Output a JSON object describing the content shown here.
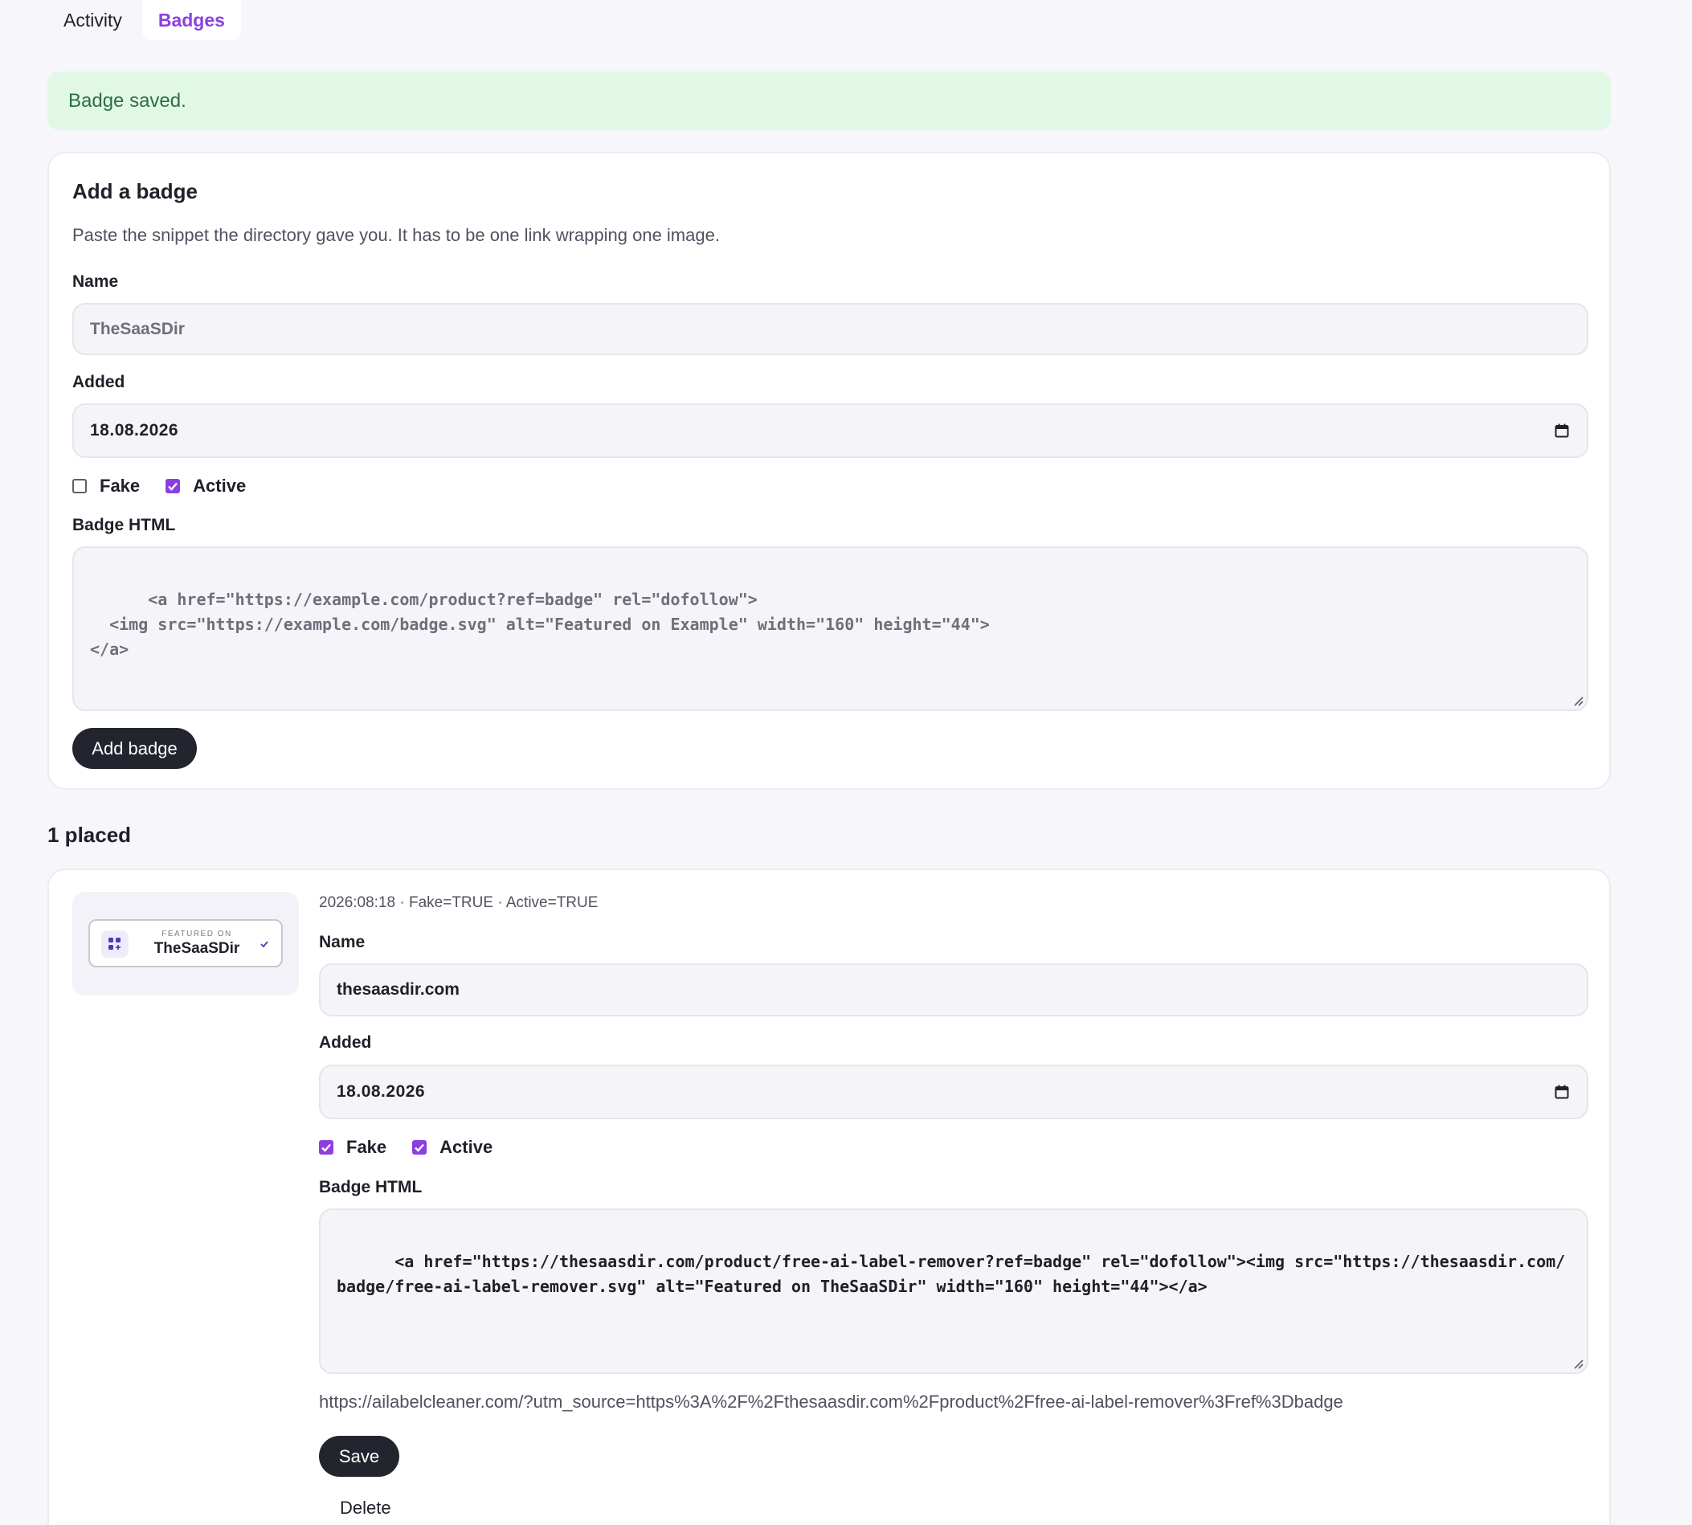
{
  "tabs": [
    {
      "label": "Activity",
      "active": false
    },
    {
      "label": "Badges",
      "active": true
    }
  ],
  "flash": {
    "message": "Badge saved."
  },
  "add_form": {
    "title": "Add a badge",
    "description": "Paste the snippet the directory gave you. It has to be one link wrapping one image.",
    "name_label": "Name",
    "name_placeholder": "TheSaaSDir",
    "added_label": "Added",
    "added_value": "18.08.2026",
    "fake_label": "Fake",
    "fake_checked": false,
    "active_label": "Active",
    "active_checked": true,
    "html_label": "Badge HTML",
    "html_placeholder": "<a href=\"https://example.com/product?ref=badge\" rel=\"dofollow\">\n  <img src=\"https://example.com/badge.svg\" alt=\"Featured on Example\" width=\"160\" height=\"44\">\n</a>",
    "submit_label": "Add badge"
  },
  "placed": {
    "count_label": "1 placed",
    "items": [
      {
        "preview": {
          "small_text": "FEATURED ON",
          "name": "TheSaaSDir"
        },
        "meta": "2026:08:18 · Fake=TRUE · Active=TRUE",
        "name_label": "Name",
        "name_value": "thesaasdir.com",
        "added_label": "Added",
        "added_value": "18.08.2026",
        "fake_label": "Fake",
        "fake_checked": true,
        "active_label": "Active",
        "active_checked": true,
        "html_label": "Badge HTML",
        "html_value": "<a href=\"https://thesaasdir.com/product/free-ai-label-remover?ref=badge\" rel=\"dofollow\"><img src=\"https://thesaasdir.com/badge/free-ai-label-remover.svg\" alt=\"Featured on TheSaaSDir\" width=\"160\" height=\"44\"></a>",
        "tracking_url": "https://ailabelcleaner.com/?utm_source=https%3A%2F%2Fthesaasdir.com%2Fproduct%2Ffree-ai-label-remover%3Fref%3Dbadge",
        "save_label": "Save",
        "delete_label": "Delete"
      }
    ]
  },
  "colors": {
    "accent": "#8b3fe0",
    "success_bg": "#e2f8e7",
    "success_text": "#2f6e3f",
    "button_dark": "#23252e"
  },
  "icons": [
    "calendar-icon",
    "checkbox-check-icon",
    "resize-handle-icon",
    "badge-logo-icon",
    "verified-check-icon"
  ]
}
